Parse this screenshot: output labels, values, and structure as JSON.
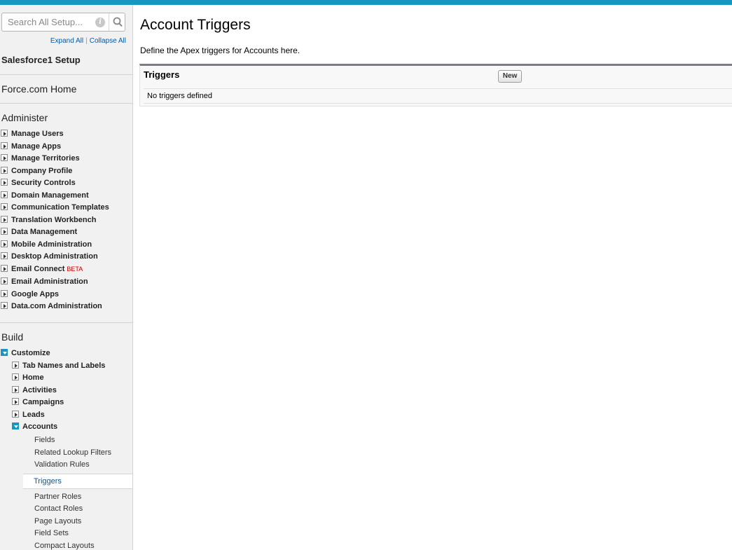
{
  "search": {
    "placeholder": "Search All Setup..."
  },
  "sidebar": {
    "expand_all": "Expand All",
    "separator": "|",
    "collapse_all": "Collapse All",
    "salesforce1_setup": "Salesforce1 Setup",
    "forcecom_home": "Force.com Home",
    "administer": {
      "heading": "Administer",
      "items": [
        "Manage Users",
        "Manage Apps",
        "Manage Territories",
        "Company Profile",
        "Security Controls",
        "Domain Management",
        "Communication Templates",
        "Translation Workbench",
        "Data Management",
        "Mobile Administration",
        "Desktop Administration",
        "Email Connect",
        "Email Administration",
        "Google Apps",
        "Data.com Administration"
      ],
      "beta_label": "BETA"
    },
    "build": {
      "heading": "Build",
      "customize": "Customize",
      "customize_items": [
        "Tab Names and Labels",
        "Home",
        "Activities",
        "Campaigns",
        "Leads",
        "Accounts"
      ],
      "accounts_items": [
        "Fields",
        "Related Lookup Filters",
        "Validation Rules",
        "Triggers",
        "Partner Roles",
        "Contact Roles",
        "Page Layouts",
        "Field Sets",
        "Compact Layouts"
      ]
    }
  },
  "main": {
    "title": "Account Triggers",
    "description": "Define the Apex triggers for Accounts here.",
    "panel": {
      "title": "Triggers",
      "new_label": "New",
      "empty_text": "No triggers defined"
    }
  },
  "colors": {
    "accent": "#1797c0",
    "link": "#015ba7",
    "beta": "#cc0000"
  }
}
